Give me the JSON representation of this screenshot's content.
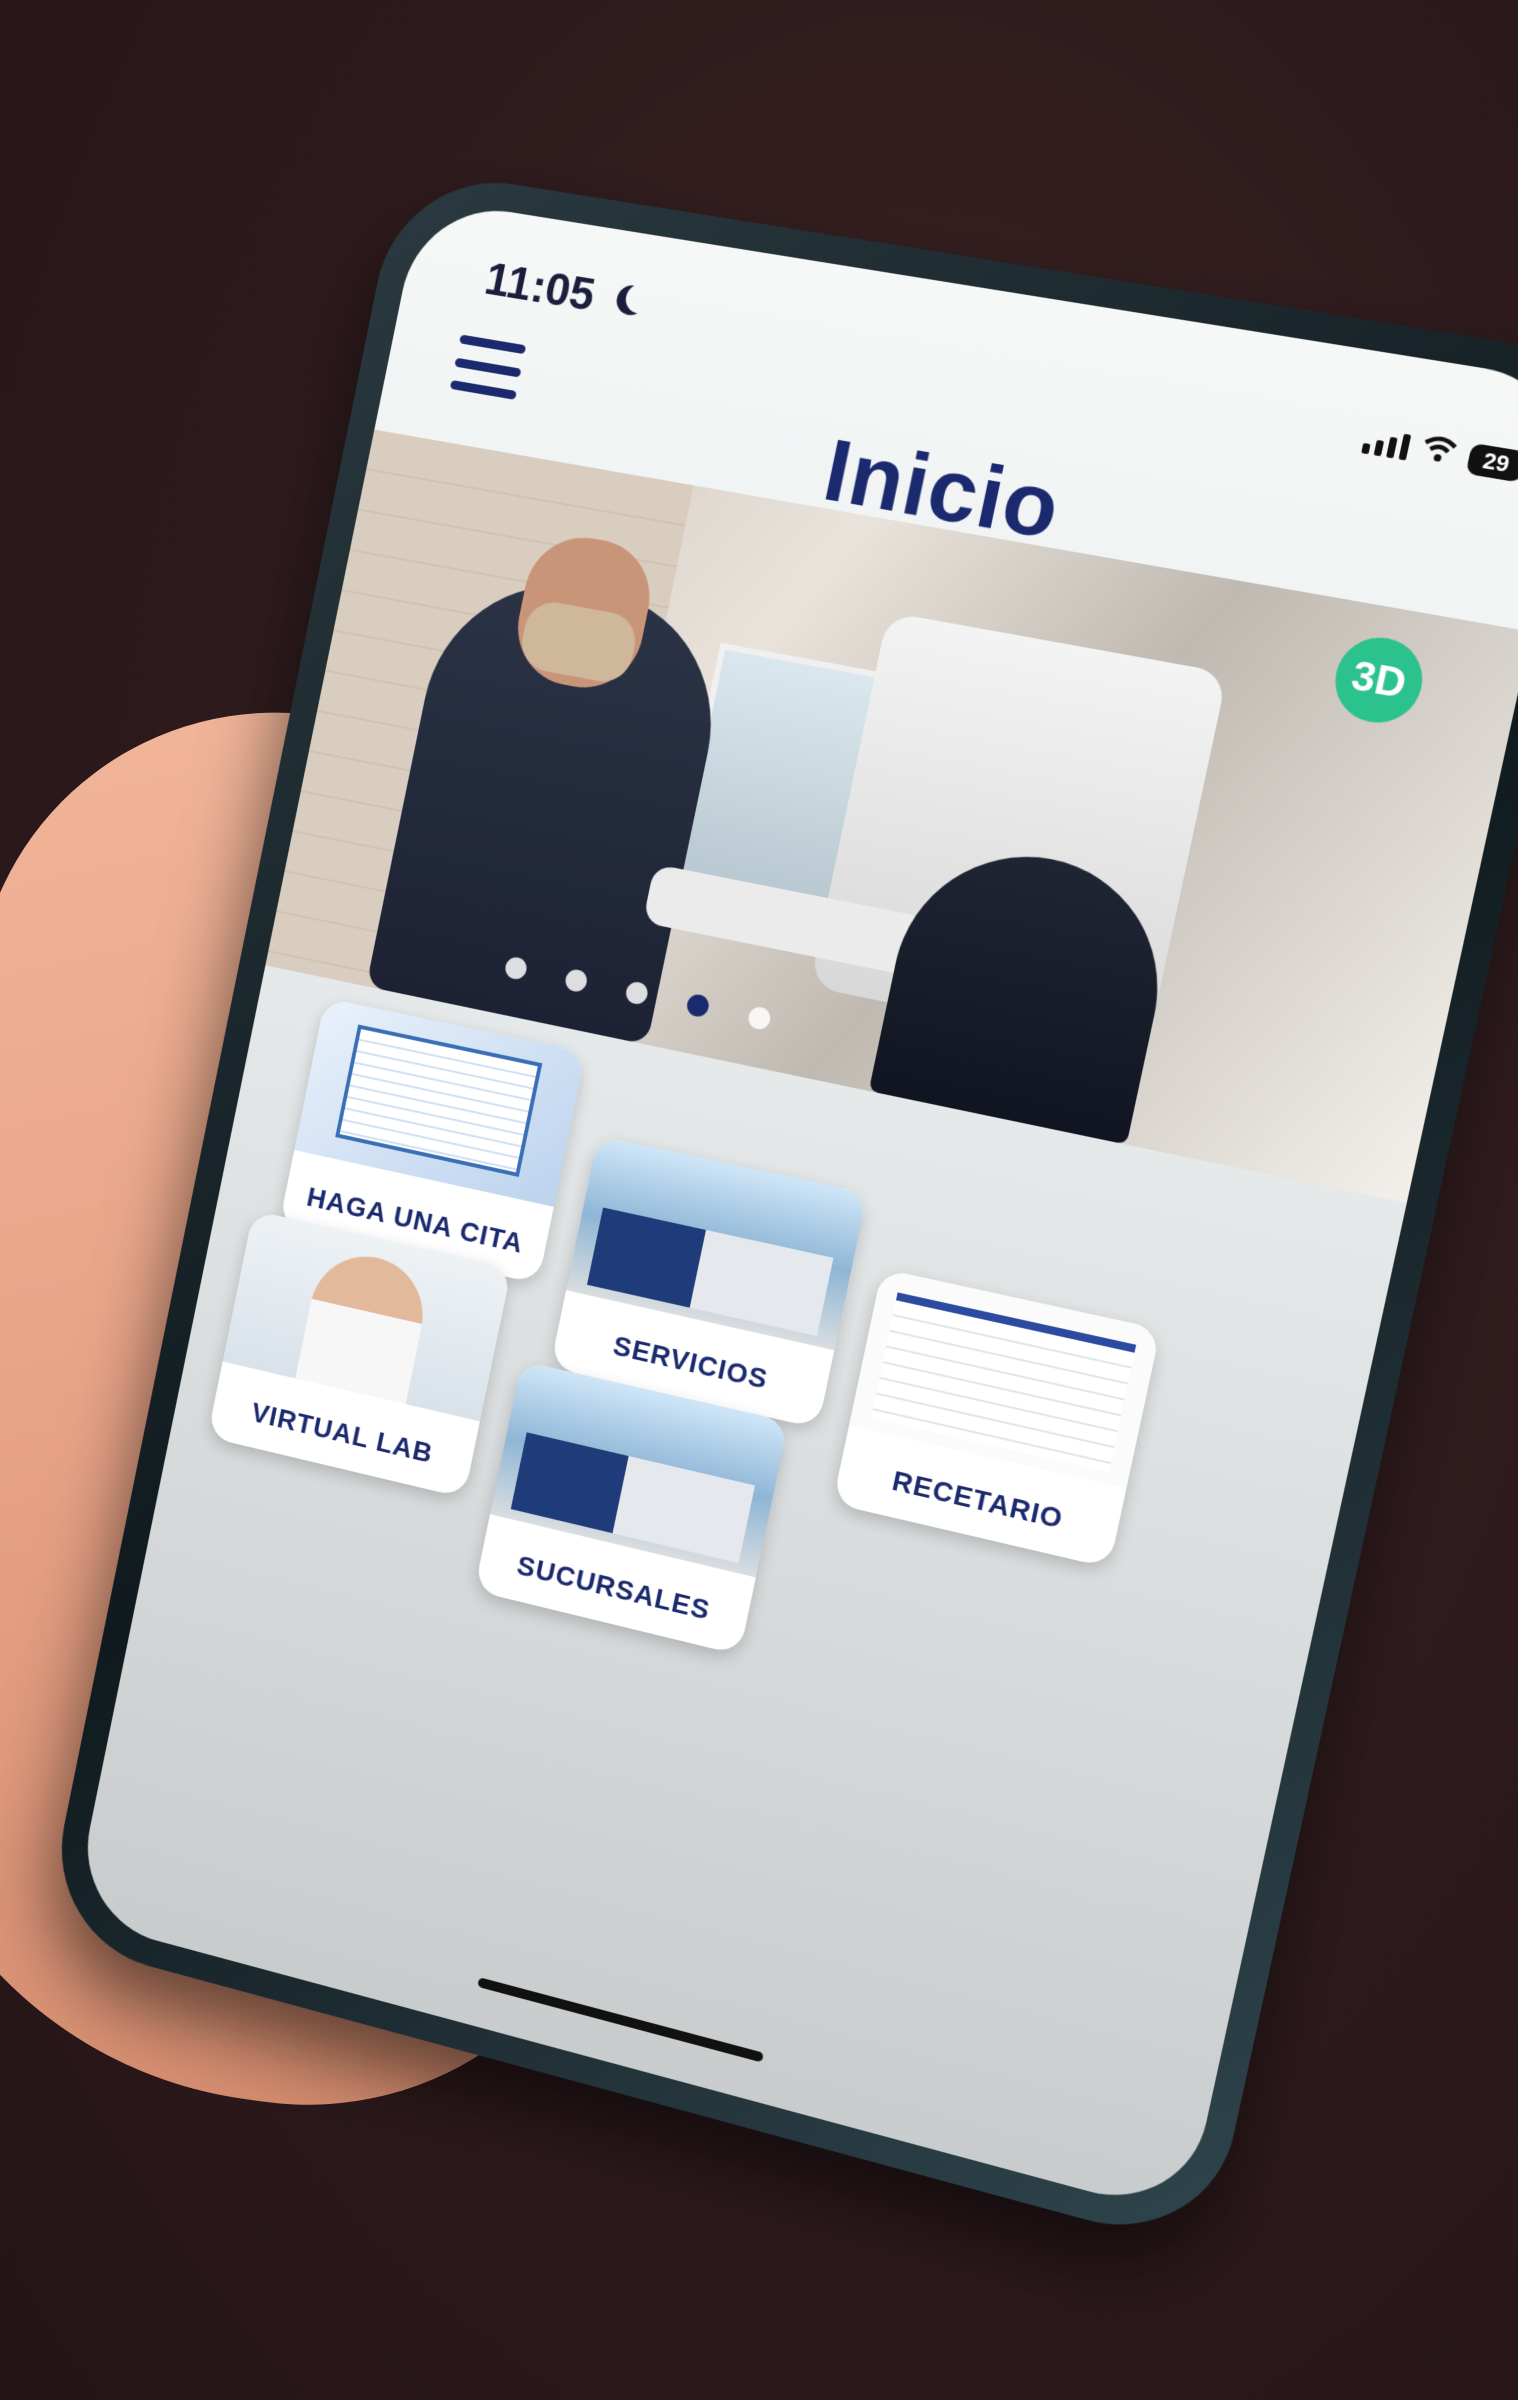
{
  "status_bar": {
    "time": "11:05",
    "battery": "29",
    "icons": [
      "moon-icon",
      "signal-icon",
      "wifi-icon"
    ]
  },
  "header": {
    "title": "Inicio",
    "badge_3d": "3D",
    "menu_icon": "hamburger-icon"
  },
  "hero": {
    "carousel_slides": 5,
    "active_slide": 4
  },
  "tiles": [
    {
      "label": "HAGA UNA CITA"
    },
    {
      "label": "SERVICIOS"
    },
    {
      "label": "RECETARIO"
    },
    {
      "label": "VIRTUAL LAB"
    },
    {
      "label": "SUCURSALES"
    }
  ],
  "colors": {
    "brand_navy": "#1b2a6e",
    "accent_green": "#2cc28e"
  }
}
